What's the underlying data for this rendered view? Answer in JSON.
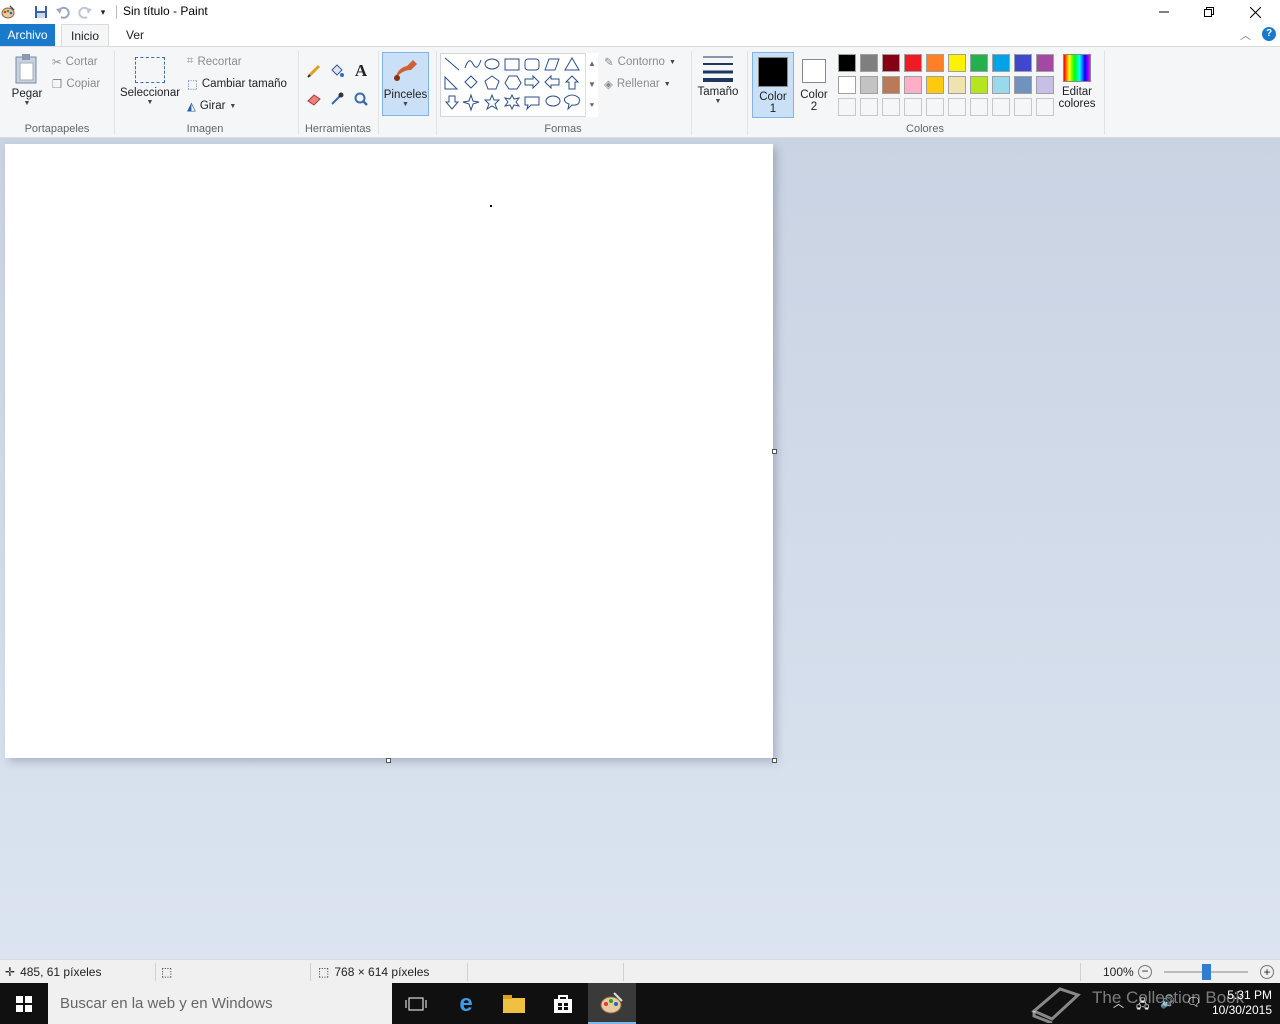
{
  "window": {
    "title": "Sin título - Paint"
  },
  "tabs": {
    "file": "Archivo",
    "home": "Inicio",
    "view": "Ver"
  },
  "ribbon": {
    "clipboard": {
      "label": "Portapapeles",
      "paste": "Pegar",
      "cut": "Cortar",
      "copy": "Copiar"
    },
    "image": {
      "label": "Imagen",
      "select": "Seleccionar",
      "crop": "Recortar",
      "resize": "Cambiar tamaño",
      "rotate": "Girar"
    },
    "tools": {
      "label": "Herramientas"
    },
    "brushes": {
      "label": "Pinceles"
    },
    "shapes": {
      "label": "Formas",
      "outline": "Contorno",
      "fill": "Rellenar"
    },
    "size": {
      "label": "Tamaño"
    },
    "colors": {
      "label": "Colores",
      "color1": "Color",
      "color1_num": "1",
      "color2": "Color",
      "color2_num": "2",
      "edit": "Editar",
      "edit2": "colores",
      "palette_row1": [
        "#000000",
        "#7f7f7f",
        "#880015",
        "#ed1c24",
        "#ff7f27",
        "#fff200",
        "#22b14c",
        "#00a2e8",
        "#3f48cc",
        "#a349a4"
      ],
      "palette_row2": [
        "#ffffff",
        "#c3c3c3",
        "#b97a57",
        "#ffaec9",
        "#ffc90e",
        "#efe4b0",
        "#b5e61d",
        "#99d9ea",
        "#7092be",
        "#c8bfe7"
      ]
    }
  },
  "status": {
    "cursor": "485, 61 píxeles",
    "canvas_size": "768 × 614 píxeles",
    "zoom": "100%"
  },
  "taskbar": {
    "search_placeholder": "Buscar en la web y en Windows",
    "time": "5:31 PM",
    "date": "10/30/2015",
    "watermark": "The Collection Book"
  }
}
